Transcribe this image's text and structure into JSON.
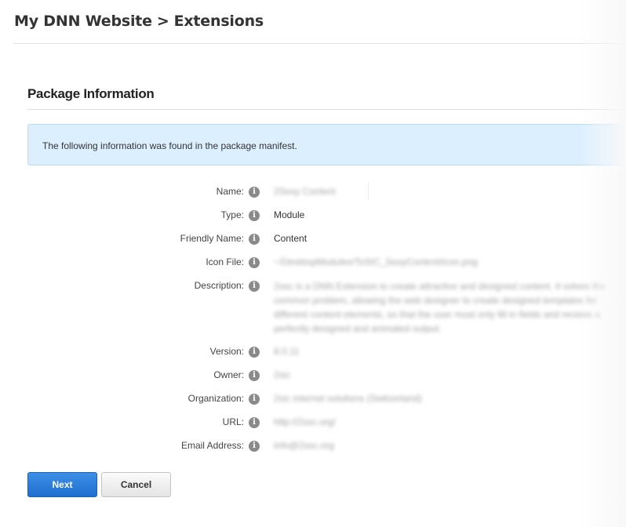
{
  "breadcrumb": {
    "site": "My DNN Website",
    "separator": ">",
    "page": "Extensions"
  },
  "section_title": "Package Information",
  "info_message": "The following information was found in the package manifest.",
  "fields": [
    {
      "label": "Name:",
      "value": "2Sexy Content",
      "blurred": true
    },
    {
      "label": "Type:",
      "value": "Module",
      "blurred": false
    },
    {
      "label": "Friendly Name:",
      "value": "Content",
      "blurred": false
    },
    {
      "label": "Icon File:",
      "value": "~/DesktopModules/ToSIC_SexyContent/icon.png",
      "blurred": true
    },
    {
      "label": "Description:",
      "value": "2sxc is a DNN Extension to create attractive and designed content. It solves the common problem, allowing the web designer to create designed templates for different content elements, so that the user must only fill in fields and receive a perfectly designed and animated output.",
      "blurred": true
    },
    {
      "label": "Version:",
      "value": "8.0.11",
      "blurred": true
    },
    {
      "label": "Owner:",
      "value": "2sic",
      "blurred": true
    },
    {
      "label": "Organization:",
      "value": "2sic internet solutions (Switzerland)",
      "blurred": true
    },
    {
      "label": "URL:",
      "value": "http://2sxc.org/",
      "blurred": true
    },
    {
      "label": "Email Address:",
      "value": "info@2sxc.org",
      "blurred": true
    }
  ],
  "icons": {
    "field_info": "info-icon"
  },
  "buttons": {
    "next": "Next",
    "cancel": "Cancel"
  },
  "colors": {
    "primary_button": "#2a7ddb",
    "info_background": "#dcefff"
  }
}
